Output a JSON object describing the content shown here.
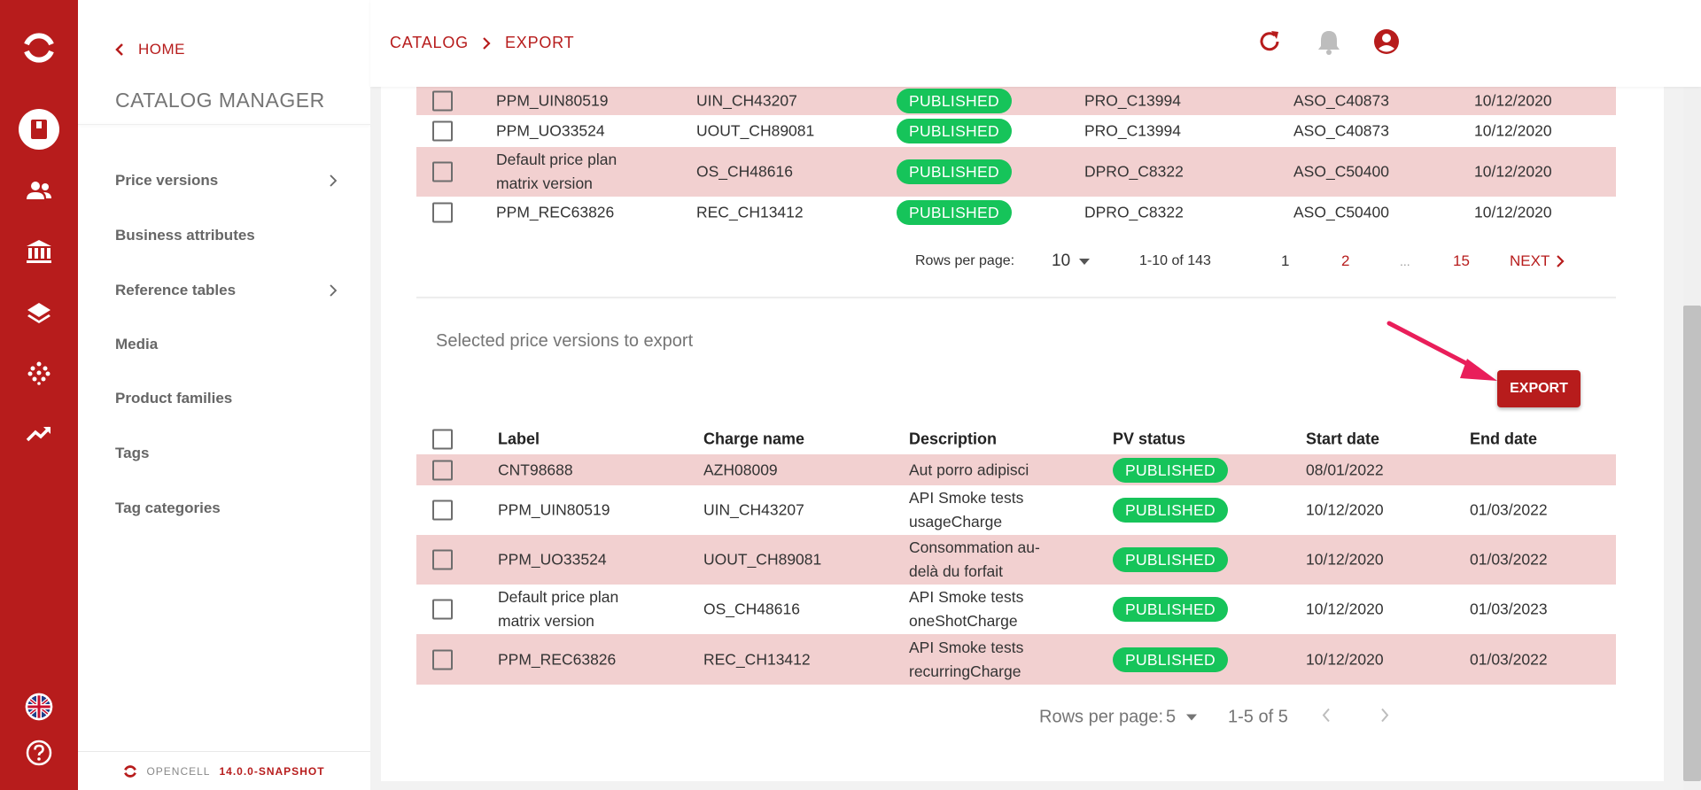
{
  "app": {
    "name": "OPENCELL",
    "version": "14.0.0-SNAPSHOT"
  },
  "colors": {
    "brand": "#b71c1c",
    "row_highlight": "#f2d0d0",
    "published_badge": "#16c45a"
  },
  "rail": {
    "icons": [
      "opencell-logo-icon",
      "catalog-book-icon",
      "customers-icon",
      "finance-bank-icon",
      "layers-icon",
      "dots-grid-icon",
      "trending-up-icon",
      "language-flag-icon",
      "help-icon"
    ]
  },
  "sidebar": {
    "back_label": "HOME",
    "title": "CATALOG MANAGER",
    "items": [
      {
        "label": "Price versions",
        "has_submenu": true
      },
      {
        "label": "Business attributes",
        "has_submenu": false
      },
      {
        "label": "Reference tables",
        "has_submenu": true
      },
      {
        "label": "Media",
        "has_submenu": false
      },
      {
        "label": "Product families",
        "has_submenu": false
      },
      {
        "label": "Tags",
        "has_submenu": false
      },
      {
        "label": "Tag categories",
        "has_submenu": false
      }
    ]
  },
  "breadcrumb": {
    "items": [
      "CATALOG",
      "EXPORT"
    ]
  },
  "top_table": {
    "rows": [
      {
        "label": "PPM_UIN80519",
        "charge": "UIN_CH43207",
        "status": "PUBLISHED",
        "code1": "PRO_C13994",
        "code2": "ASO_C40873",
        "date": "10/12/2020",
        "highlight": true
      },
      {
        "label": "PPM_UO33524",
        "charge": "UOUT_CH89081",
        "status": "PUBLISHED",
        "code1": "PRO_C13994",
        "code2": "ASO_C40873",
        "date": "10/12/2020",
        "highlight": false
      },
      {
        "label_line1": "Default price plan",
        "label_line2": "matrix version",
        "charge": "OS_CH48616",
        "status": "PUBLISHED",
        "code1": "DPRO_C8322",
        "code2": "ASO_C50400",
        "date": "10/12/2020",
        "highlight": true
      },
      {
        "label": "PPM_REC63826",
        "charge": "REC_CH13412",
        "status": "PUBLISHED",
        "code1": "DPRO_C8322",
        "code2": "ASO_C50400",
        "date": "10/12/2020",
        "highlight": false
      }
    ],
    "pagination": {
      "rows_per_page_label": "Rows per page:",
      "rows_per_page": "10",
      "range": "1-10 of 143",
      "pages": [
        "1",
        "2",
        "...",
        "15"
      ],
      "next_label": "NEXT"
    }
  },
  "selected": {
    "title": "Selected price versions to export",
    "export_label": "EXPORT",
    "headers": [
      "Label",
      "Charge name",
      "Description",
      "PV status",
      "Start date",
      "End date"
    ],
    "rows": [
      {
        "label": "CNT98688",
        "charge": "AZH08009",
        "desc1": "Aut porro adipisci",
        "desc2": "",
        "status": "PUBLISHED",
        "start": "08/01/2022",
        "end": "",
        "highlight": true
      },
      {
        "label": "PPM_UIN80519",
        "charge": "UIN_CH43207",
        "desc1": "API Smoke tests",
        "desc2": "usageCharge",
        "status": "PUBLISHED",
        "start": "10/12/2020",
        "end": "01/03/2022",
        "highlight": false
      },
      {
        "label": "PPM_UO33524",
        "charge": "UOUT_CH89081",
        "desc1": "Consommation au-",
        "desc2": "delà du forfait",
        "status": "PUBLISHED",
        "start": "10/12/2020",
        "end": "01/03/2022",
        "highlight": true
      },
      {
        "label_line1": "Default price plan",
        "label_line2": "matrix version",
        "charge": "OS_CH48616",
        "desc1": "API Smoke tests",
        "desc2": "oneShotCharge",
        "status": "PUBLISHED",
        "start": "10/12/2020",
        "end": "01/03/2023",
        "highlight": false
      },
      {
        "label": "PPM_REC63826",
        "charge": "REC_CH13412",
        "desc1": "API Smoke tests",
        "desc2": "recurringCharge",
        "status": "PUBLISHED",
        "start": "10/12/2020",
        "end": "01/03/2022",
        "highlight": true
      }
    ],
    "pagination": {
      "rows_per_page_label": "Rows per page:",
      "rows_per_page": "5",
      "range": "1-5 of 5"
    }
  }
}
